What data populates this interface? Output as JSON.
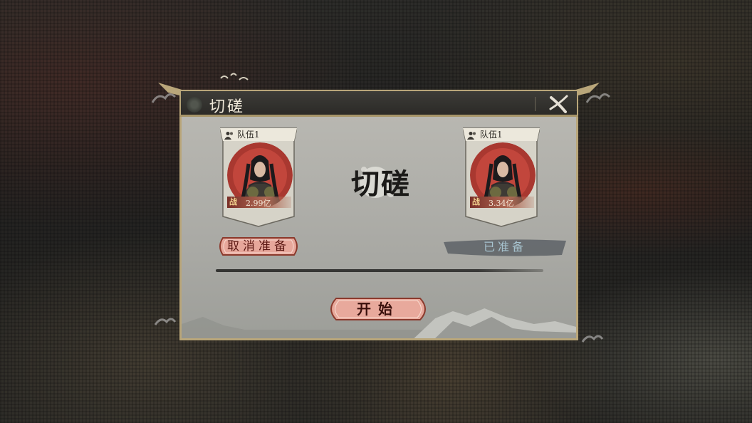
{
  "dialog": {
    "title": "切磋",
    "center_title": "切磋"
  },
  "teams": {
    "left": {
      "label": "队伍1",
      "power_icon": "战",
      "power": "2.99亿"
    },
    "right": {
      "label": "队伍1",
      "power_icon": "战",
      "power": "3.34亿"
    }
  },
  "buttons": {
    "cancel_ready": "取消准备",
    "ready_status": "已准备",
    "start": "开始"
  },
  "icons": {
    "close": "close-x-icon",
    "team": "team-people-icon",
    "power": "battle-power-icon"
  },
  "colors": {
    "frame_gold": "#b9a67a",
    "button_red": "#e7a79b",
    "ready_slate": "#5d6166"
  }
}
